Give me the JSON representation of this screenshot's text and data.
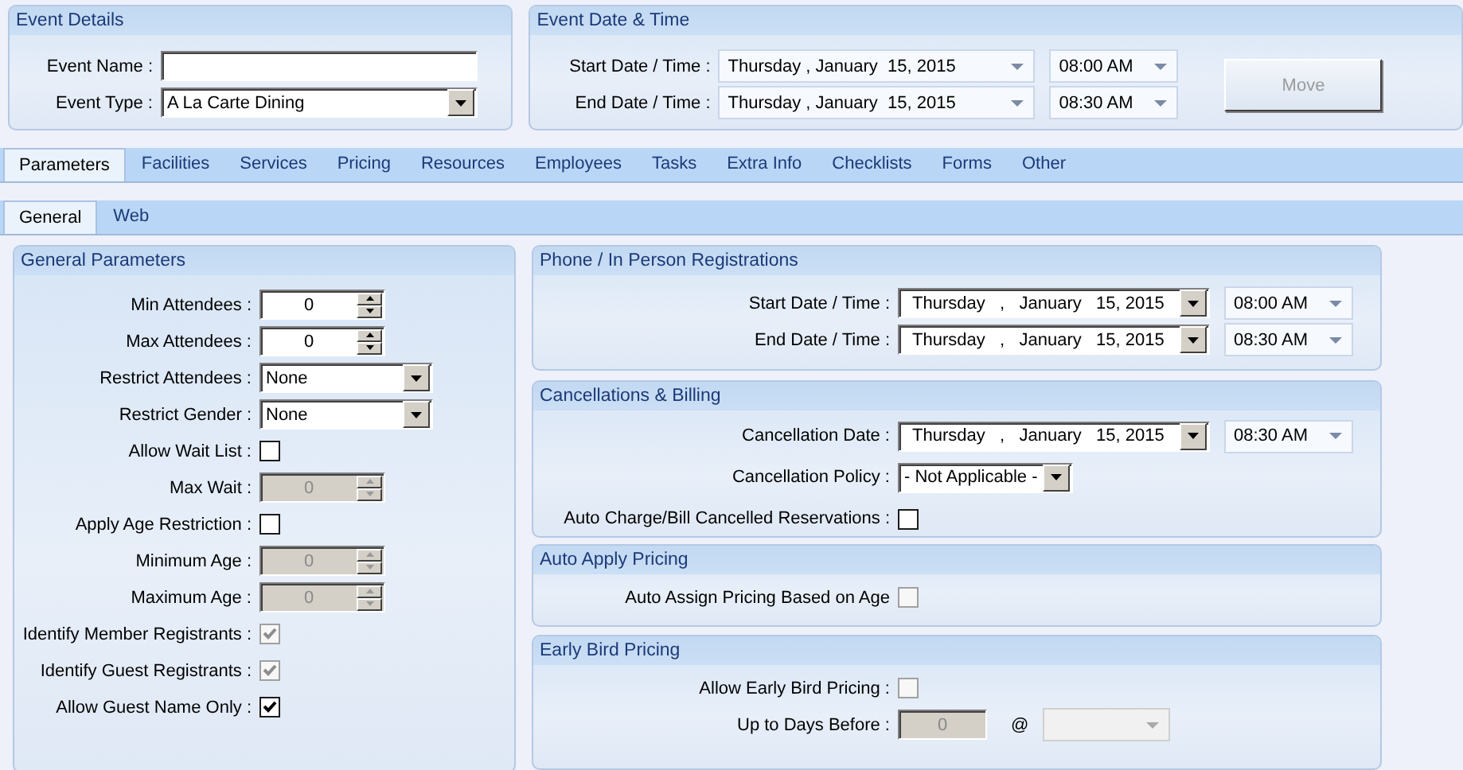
{
  "event_details": {
    "title": "Event Details",
    "rows": [
      {
        "kind": "text",
        "label": "Event Name :"
      },
      {
        "kind": "dropdown",
        "label": "Event Type :",
        "value": "A La Carte Dining"
      }
    ]
  },
  "event_date_time": {
    "title": "Event Date & Time",
    "rows": [
      {
        "kind": "datetime",
        "label": "Start Date / Time :",
        "date": "Thursday , January  15, 2015",
        "time": "08:00 AM"
      },
      {
        "kind": "datetime",
        "label": "End Date / Time :",
        "date": "Thursday , January  15, 2015",
        "time": "08:30 AM"
      }
    ],
    "move_button": {
      "label": "Move",
      "disabled": true
    }
  },
  "tabs": [
    {
      "label": "Parameters",
      "selected": true
    },
    {
      "label": "Facilities",
      "selected": false
    },
    {
      "label": "Services",
      "selected": false
    },
    {
      "label": "Pricing",
      "selected": false
    },
    {
      "label": "Resources",
      "selected": false
    },
    {
      "label": "Employees",
      "selected": false
    },
    {
      "label": "Tasks",
      "selected": false
    },
    {
      "label": "Extra Info",
      "selected": false
    },
    {
      "label": "Checklists",
      "selected": false
    },
    {
      "label": "Forms",
      "selected": false
    },
    {
      "label": "Other",
      "selected": false
    }
  ],
  "subtabs": [
    {
      "label": "General",
      "selected": true
    },
    {
      "label": "Web",
      "selected": false
    }
  ],
  "general_parameters": {
    "title": "General Parameters",
    "rows": [
      {
        "kind": "spinner",
        "label": "Min Attendees :",
        "value": "0",
        "disabled": false
      },
      {
        "kind": "spinner",
        "label": "Max Attendees :",
        "value": "0",
        "disabled": false
      },
      {
        "kind": "dropdown",
        "label": "Restrict Attendees :",
        "value": "None"
      },
      {
        "kind": "dropdown",
        "label": "Restrict Gender :",
        "value": "None"
      },
      {
        "kind": "checkbox",
        "label": "Allow Wait List :",
        "checked": false,
        "disabled": false
      },
      {
        "kind": "spinner",
        "label": "Max Wait :",
        "value": "0",
        "disabled": true
      },
      {
        "kind": "checkbox",
        "label": "Apply Age Restriction :",
        "checked": false,
        "disabled": false
      },
      {
        "kind": "spinner",
        "label": "Minimum Age :",
        "value": "0",
        "disabled": true
      },
      {
        "kind": "spinner",
        "label": "Maximum Age :",
        "value": "0",
        "disabled": true
      },
      {
        "kind": "checkbox",
        "label": "Identify Member Registrants :",
        "checked": true,
        "disabled": true
      },
      {
        "kind": "checkbox",
        "label": "Identify Guest Registrants :",
        "checked": true,
        "disabled": true
      },
      {
        "kind": "checkbox",
        "label": "Allow Guest Name Only :",
        "checked": true,
        "disabled": false
      }
    ]
  },
  "right_panels": [
    {
      "title": "Phone / In Person Registrations",
      "rows": [
        {
          "kind": "datetime",
          "label": "Start Date / Time :",
          "date": "Thursday   ,   January   15, 2015",
          "time": "08:00 AM"
        },
        {
          "kind": "datetime",
          "label": "End Date / Time :",
          "date": "Thursday   ,   January   15, 2015",
          "time": "08:30 AM"
        }
      ]
    },
    {
      "title": "Cancellations & Billing",
      "rows": [
        {
          "kind": "datetime",
          "label": "Cancellation Date :",
          "date": "Thursday   ,   January   15, 2015",
          "time": "08:30 AM"
        },
        {
          "kind": "dropdown",
          "label": "Cancellation Policy :",
          "value": "- Not Applicable -"
        },
        {
          "kind": "checkbox",
          "label": "Auto Charge/Bill Cancelled Reservations :",
          "checked": false,
          "disabled": false
        }
      ]
    },
    {
      "title": "Auto Apply Pricing",
      "rows": [
        {
          "kind": "checkbox",
          "label": "Auto Assign Pricing Based on Age",
          "checked": false,
          "disabled": true
        }
      ]
    },
    {
      "title": "Early Bird Pricing",
      "rows": [
        {
          "kind": "checkbox",
          "label": "Allow Early Bird Pricing :",
          "checked": false,
          "disabled": true
        },
        {
          "kind": "days",
          "label": "Up to Days Before :",
          "value": "0",
          "symbol": "@",
          "disabled": true
        }
      ]
    }
  ]
}
